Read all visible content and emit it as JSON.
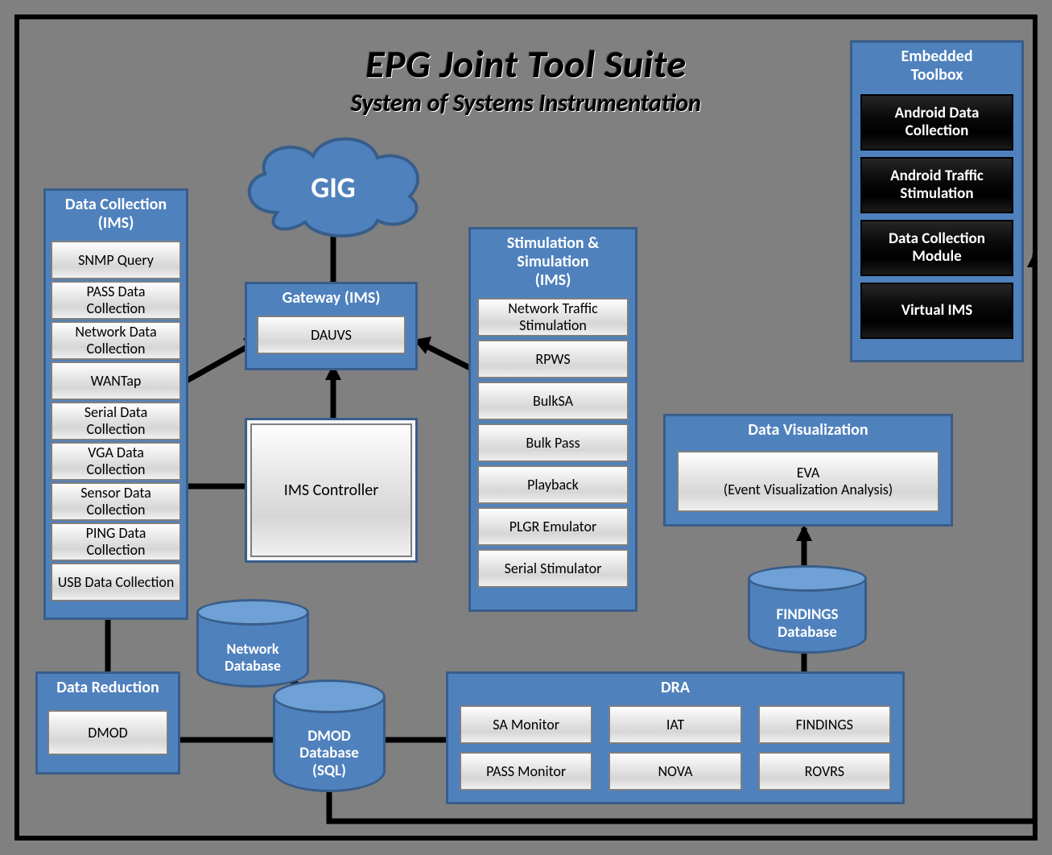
{
  "title": "EPG Joint Tool Suite",
  "subtitle": "System of Systems Instrumentation",
  "cloud": {
    "label": "GIG"
  },
  "data_collection": {
    "title": "Data Collection\n(IMS)",
    "items": [
      "SNMP Query",
      "PASS Data Collection",
      "Network Data Collection",
      "WANTap",
      "Serial Data Collection",
      "VGA Data Collection",
      "Sensor Data Collection",
      "PING Data Collection",
      "USB Data Collection"
    ]
  },
  "gateway": {
    "title": "Gateway (IMS)",
    "item": "DAUVS"
  },
  "ims_controller": {
    "label": "IMS Controller"
  },
  "stim_sim": {
    "title": "Stimulation &\nSimulation\n(IMS)",
    "items": [
      "Network Traffic Stimulation",
      "RPWS",
      "BulkSA",
      "Bulk Pass",
      "Playback",
      "PLGR Emulator",
      "Serial Stimulator"
    ]
  },
  "data_reduction": {
    "title": "Data Reduction",
    "item": "DMOD"
  },
  "dra": {
    "title": "DRA",
    "items": [
      "SA Monitor",
      "IAT",
      "FINDINGS",
      "PASS Monitor",
      "NOVA",
      "ROVRS"
    ]
  },
  "data_viz": {
    "title": "Data Visualization",
    "item": "EVA\n(Event Visualization Analysis)"
  },
  "embedded": {
    "title": "Embedded\nToolbox",
    "items": [
      "Android Data Collection",
      "Android Traffic Stimulation",
      "Data Collection Module",
      "Virtual IMS"
    ]
  },
  "db_network": {
    "label": "Network\nDatabase"
  },
  "db_dmod": {
    "label": "DMOD\nDatabase\n(SQL)"
  },
  "db_findings": {
    "label": "FINDINGS\nDatabase"
  }
}
